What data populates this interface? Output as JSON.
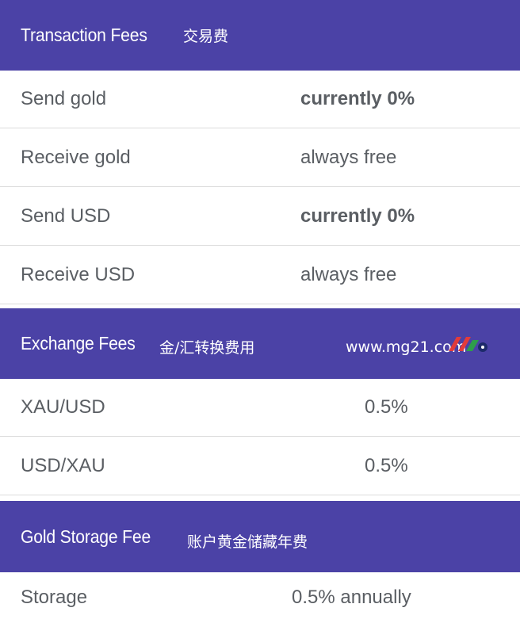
{
  "transaction": {
    "title": "Transaction Fees",
    "subtitle_cn": "交易费",
    "rows": [
      {
        "label": "Send gold",
        "value": "currently 0%"
      },
      {
        "label": "Receive gold",
        "value": "always free"
      },
      {
        "label": "Send USD",
        "value": "currently 0%"
      },
      {
        "label": "Receive USD",
        "value": "always free"
      }
    ]
  },
  "exchange": {
    "title": "Exchange Fees",
    "subtitle_cn": "金/汇转换费用",
    "watermark": "www.mg21.com",
    "rows": [
      {
        "label": "XAU/USD",
        "value": "0.5%"
      },
      {
        "label": "USD/XAU",
        "value": "0.5%"
      }
    ]
  },
  "storage": {
    "title": "Gold Storage Fee",
    "subtitle_cn": "账户黄金储藏年费",
    "rows": [
      {
        "label": "Storage",
        "value": "0.5% annually"
      }
    ]
  },
  "colors": {
    "header_bg": "#4b42a6",
    "text": "#5a5e63",
    "divider": "#dcdcdc"
  }
}
